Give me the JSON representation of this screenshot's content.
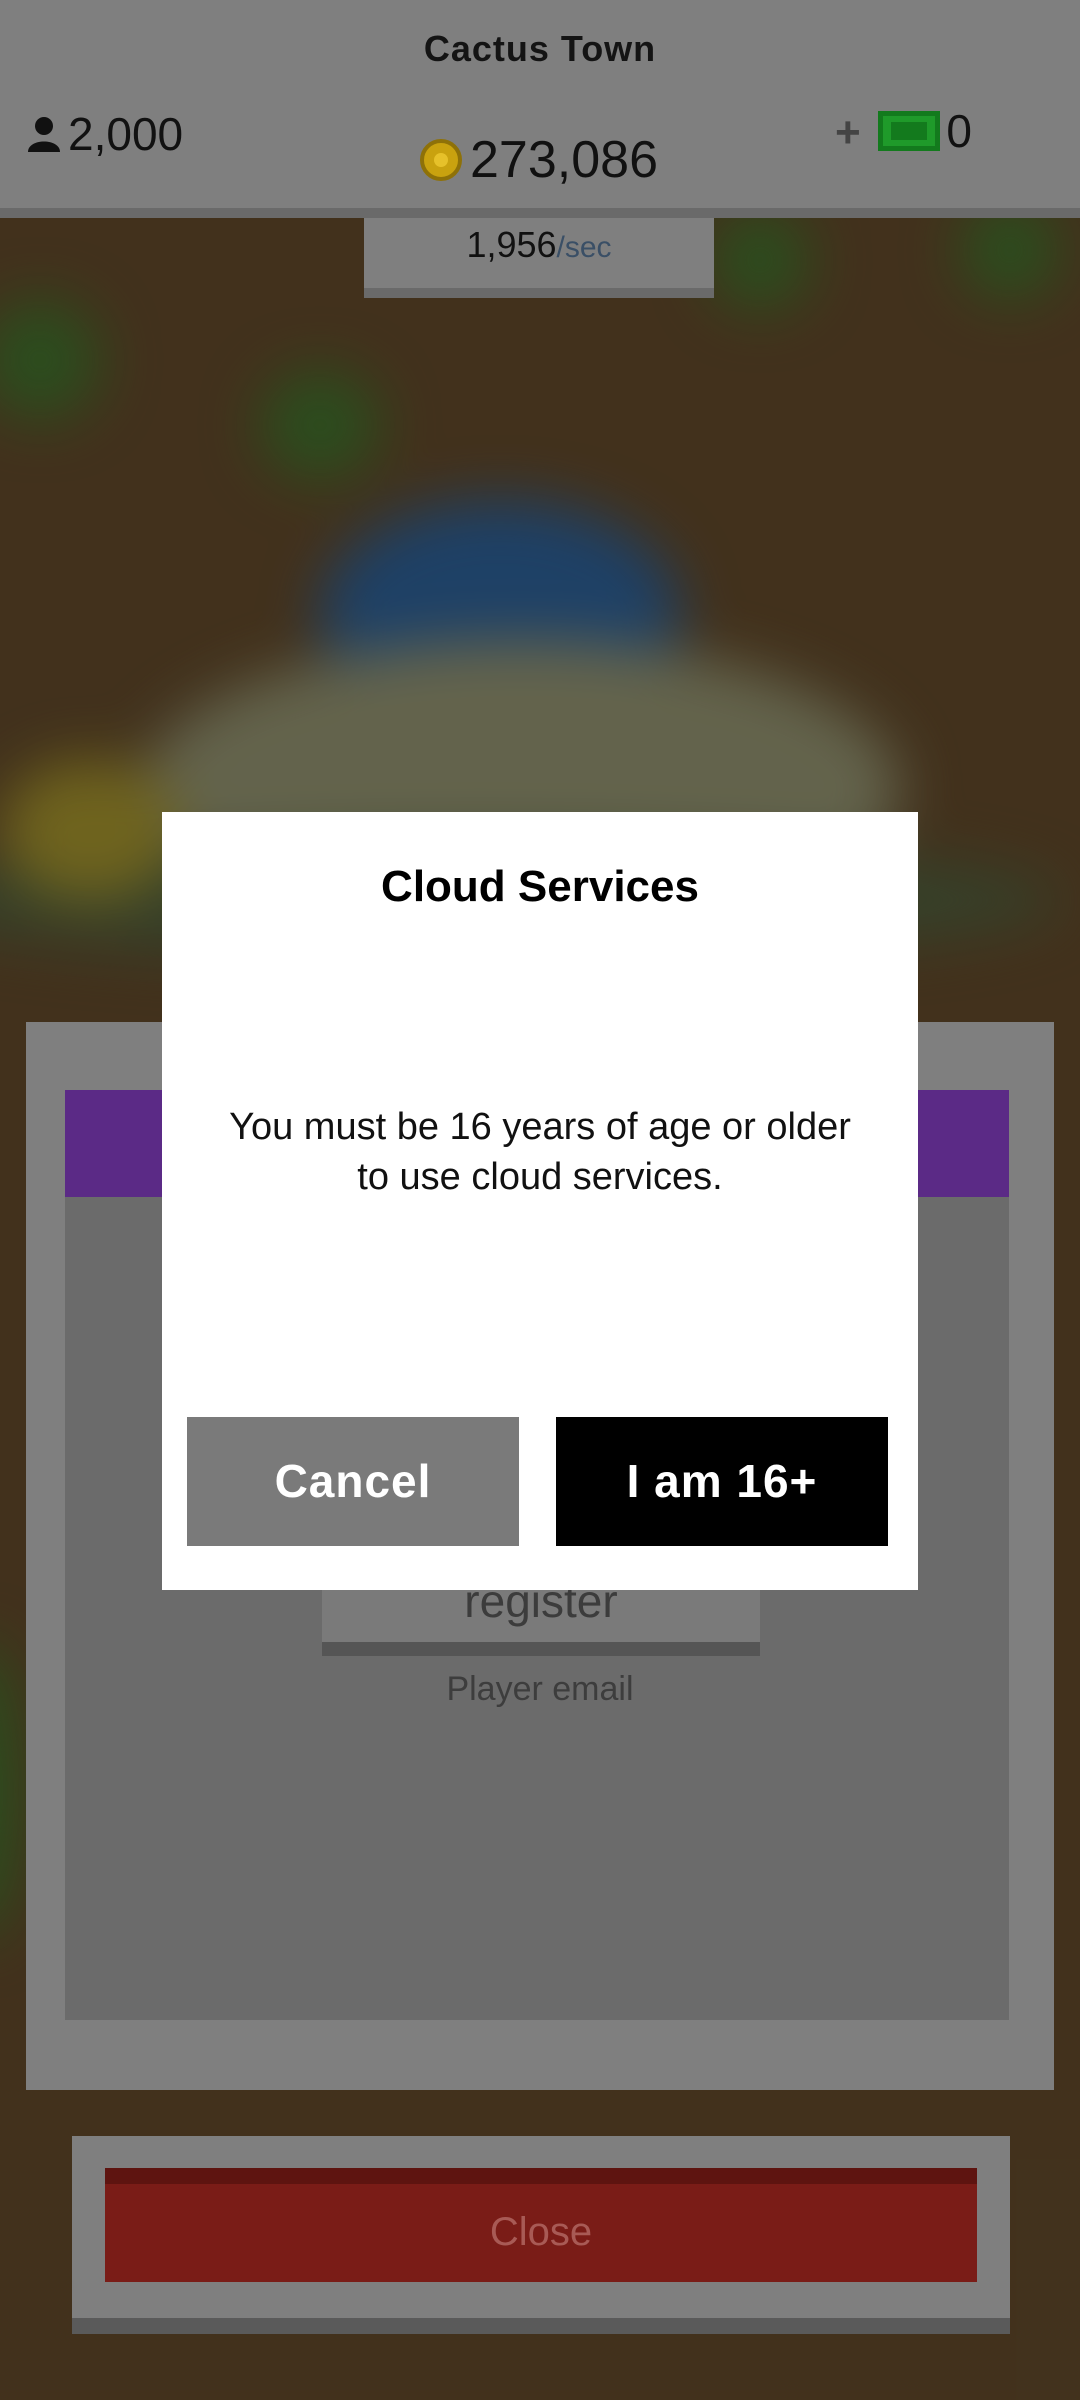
{
  "hud": {
    "town_name": "Cactus Town",
    "population": "2,000",
    "coins": "273,086",
    "rate_value": "1,956",
    "rate_unit": "/sec",
    "plus_label": "+",
    "cash": "0"
  },
  "panel": {
    "register_label": "register",
    "email_label": "Player email",
    "close_label": "Close"
  },
  "dialog": {
    "title": "Cloud Services",
    "body_line1": "You must be 16 years of age or older",
    "body_line2": "to use cloud services.",
    "cancel_label": "Cancel",
    "confirm_label": "I am 16+"
  },
  "colors": {
    "panel_header": "#5b2a86",
    "close_button": "#7a1c17",
    "confirm_button": "#000000",
    "cancel_button": "#7a7a7a"
  },
  "icons": {
    "population": "person-icon",
    "coins": "coin-icon",
    "cash": "cash-icon"
  }
}
